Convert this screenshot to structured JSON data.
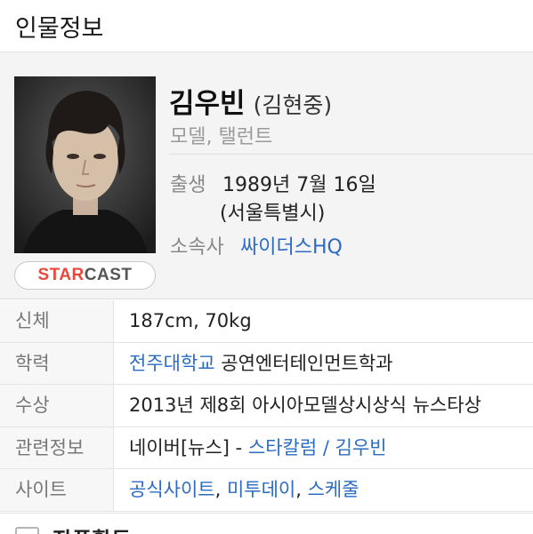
{
  "header": {
    "title": "인물정보"
  },
  "profile": {
    "name": "김우빈",
    "real_name": "(김현중)",
    "job": "모델, 탤런트",
    "birth_label": "출생",
    "birth_date": "1989년 7월 16일",
    "birth_place": "(서울특별시)",
    "agency_label": "소속사",
    "agency_value": "싸이더스HQ",
    "starcast": {
      "part1": "STAR",
      "part2": "CAST"
    }
  },
  "info_rows": [
    {
      "label": "신체",
      "value": "187cm, 70kg"
    },
    {
      "label": "학력",
      "link": "전주대학교",
      "rest": " 공연엔터테인먼트학과"
    },
    {
      "label": "수상",
      "value": "2013년 제8회 아시아모델상시상식 뉴스타상"
    },
    {
      "label": "관련정보",
      "prefix": "네이버[뉴스] - ",
      "link": "스타칼럼 / 김우빈"
    },
    {
      "label": "사이트",
      "links": [
        "공식사이트",
        "미투데이",
        "스케줄"
      ],
      "sep": ", "
    }
  ],
  "bottom": {
    "title": "작품활동"
  },
  "colors": {
    "link": "#2b6cc2",
    "brand_red": "#e8483c",
    "label_bg": "#f7f7f7"
  }
}
